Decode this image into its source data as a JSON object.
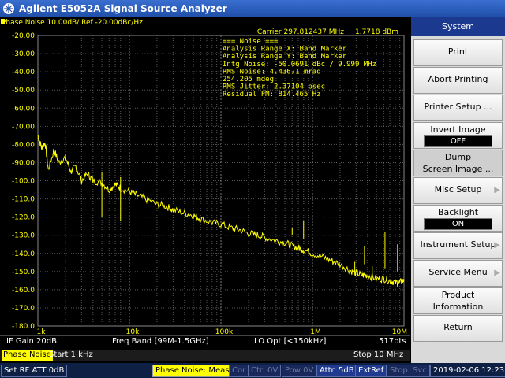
{
  "window": {
    "title": "Agilent E5052A Signal Source Analyzer",
    "logo_icon": "agilent-spark-icon"
  },
  "plot": {
    "trace_header": "Phase Noise 10.00dB/ Ref -20.00dBc/Hz",
    "carrier": "Carrier 297.812437 MHz",
    "carrier_power": "1.7718 dBm",
    "noise_panel": [
      "=== Noise ===",
      "Analysis Range X: Band Marker",
      "Analysis Range Y: Band Marker",
      "Intg Noise: -50.0691 dBc / 9.999 MHz",
      " RMS Noise: 4.43671 mrad",
      "            254.205 mdeg",
      "RMS Jitter: 2.37104 psec",
      "Residual FM: 814.465 Hz"
    ],
    "colors": {
      "trace": "#ffff00",
      "grid": "#5a5a5a",
      "text": "#ffff00"
    }
  },
  "chart_data": {
    "type": "line",
    "title": "Phase Noise 10.00dB/ Ref -20.00dBc/Hz",
    "x_scale": "log",
    "xlim": [
      1000,
      10000000
    ],
    "ylim": [
      -180,
      -20
    ],
    "y_ticks": [
      "-20.00",
      "-30.00",
      "-40.00",
      "-50.00",
      "-60.00",
      "-70.00",
      "-80.00",
      "-90.00",
      "-100.0",
      "-110.0",
      "-120.0",
      "-130.0",
      "-140.0",
      "-150.0",
      "-160.0",
      "-170.0",
      "-180.0"
    ],
    "x_ticks": [
      {
        "value": 1000,
        "label": "1k"
      },
      {
        "value": 10000,
        "label": "10k"
      },
      {
        "value": 100000,
        "label": "100k"
      },
      {
        "value": 1000000,
        "label": "1M"
      },
      {
        "value": 10000000,
        "label": "10M"
      }
    ],
    "series": [
      {
        "x": [
          1000,
          1100,
          1200,
          1300,
          1500,
          1700,
          2000,
          2300,
          2600,
          3000,
          3500,
          4000,
          5000,
          6000,
          7000,
          8000,
          10000,
          12000,
          15000,
          20000,
          25000,
          30000,
          40000,
          50000,
          60000,
          80000,
          100000,
          130000,
          160000,
          200000,
          250000,
          300000,
          400000,
          500000,
          600000,
          700000,
          800000,
          1000000,
          1300000,
          1600000,
          2000000,
          2500000,
          3000000,
          3500000,
          4000000,
          5000000,
          6000000,
          7000000,
          8000000,
          9000000,
          10000000
        ],
        "y": [
          -75,
          -82,
          -79,
          -94,
          -83,
          -90,
          -87,
          -95,
          -92,
          -100,
          -96,
          -100,
          -101,
          -105,
          -102,
          -104,
          -106,
          -108,
          -110,
          -113,
          -114,
          -116,
          -118,
          -119,
          -121,
          -123,
          -124,
          -126,
          -127,
          -129,
          -130,
          -131,
          -133,
          -134,
          -136,
          -137,
          -138,
          -140,
          -142,
          -144,
          -146,
          -149,
          -151,
          -152,
          -152,
          -154,
          -154,
          -155,
          -156,
          -156,
          -155
        ]
      },
      {
        "x": [
          5000,
          8000,
          600000,
          800000,
          2900000,
          3700000,
          4500000,
          6200000,
          8500000
        ],
        "y": [
          -120,
          -122,
          -126,
          -122,
          -152,
          -136,
          -155,
          -128,
          -135
        ]
      }
    ]
  },
  "info": {
    "if_gain": "IF Gain 20dB",
    "freq_band": "Freq Band [99M-1.5GHz]",
    "lo_opt": "LO Opt [<150kHz]",
    "points": "517pts",
    "trace_label": "Phase Noise",
    "start": "Start 1 kHz",
    "stop": "Stop 10 MHz"
  },
  "status": {
    "set_rf": "Set RF ATT 0dB",
    "meas": "Phase Noise: Meas",
    "cor": "Cor",
    "ctrl": "Ctrl",
    "ctrl_val": "0V",
    "pow": "Pow",
    "pow_val": "0V",
    "attn": "Attn 5dB",
    "extref": "ExtRef",
    "stop": "Stop",
    "svc": "Svc",
    "datetime": "2019-02-06 12:23"
  },
  "softkeys": {
    "menu_title": "System",
    "print": "Print",
    "abort_printing": "Abort Printing",
    "printer_setup": "Printer Setup ...",
    "invert_image": "Invert Image",
    "invert_image_value": "OFF",
    "dump_line1": "Dump",
    "dump_line2": "Screen Image ...",
    "misc_setup": "Misc Setup",
    "backlight": "Backlight",
    "backlight_value": "ON",
    "instrument_setup": "Instrument Setup",
    "service_menu": "Service Menu",
    "product_line1": "Product",
    "product_line2": "Information",
    "return": "Return",
    "submenu_icon": "triangle-right-icon"
  }
}
